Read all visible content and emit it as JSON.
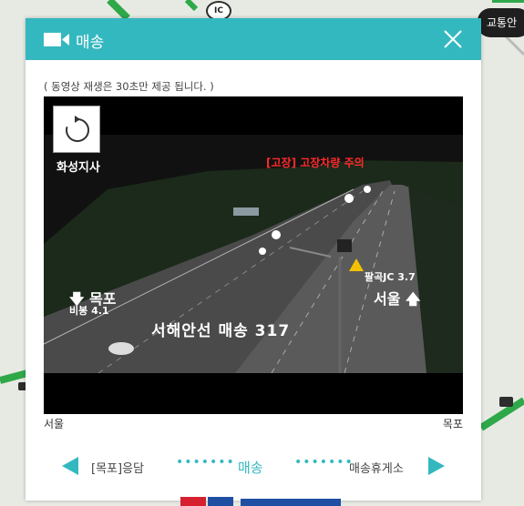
{
  "map": {
    "ic_badge": "IC",
    "traffic_label": "교통안"
  },
  "popup": {
    "title": "매송",
    "notice": "( 동영상 재생은 30초만 제공 됩니다. )",
    "video": {
      "branch": "화성지사",
      "alert": "[고장] 고장차량 주의",
      "direction_left": "🡇 목포",
      "subsign_left": "비봉 4.1",
      "junction": "팔곡JC 3.7",
      "direction_right": "서울 🡅",
      "caption": "서해안선  매송  317"
    },
    "direction_start": "서울",
    "direction_end": "목포",
    "nav": {
      "prev_label": "[목포]응담",
      "dots": "•••••••",
      "current_label": "매송",
      "next_label": "매송휴게소"
    }
  },
  "colors": {
    "accent": "#34b8c0",
    "road_green": "#2fa84a"
  }
}
